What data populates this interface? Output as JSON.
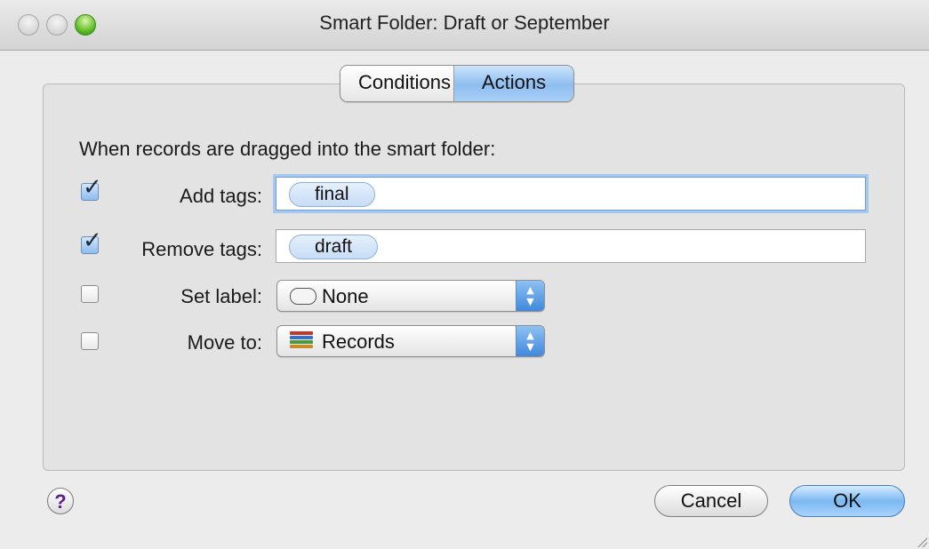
{
  "window": {
    "title": "Smart Folder: Draft or September"
  },
  "tabs": [
    {
      "label": "Conditions",
      "selected": false
    },
    {
      "label": "Actions",
      "selected": true
    }
  ],
  "actions": {
    "description": "When records are dragged into the smart folder:",
    "add_tags": {
      "label": "Add tags:",
      "checked": true,
      "token": "final"
    },
    "remove_tags": {
      "label": "Remove tags:",
      "checked": true,
      "token": "draft"
    },
    "set_label": {
      "label": "Set label:",
      "checked": false,
      "value": "None",
      "icon": "oval-label-icon"
    },
    "move_to": {
      "label": "Move to:",
      "checked": false,
      "value": "Records",
      "icon": "database-books-icon"
    }
  },
  "footer": {
    "help": "?",
    "cancel_label": "Cancel",
    "ok_label": "OK"
  },
  "colors": {
    "accent": "#8dbdf0",
    "checkmark": "#1e2b3d",
    "help_glyph": "#5a1f8c"
  }
}
